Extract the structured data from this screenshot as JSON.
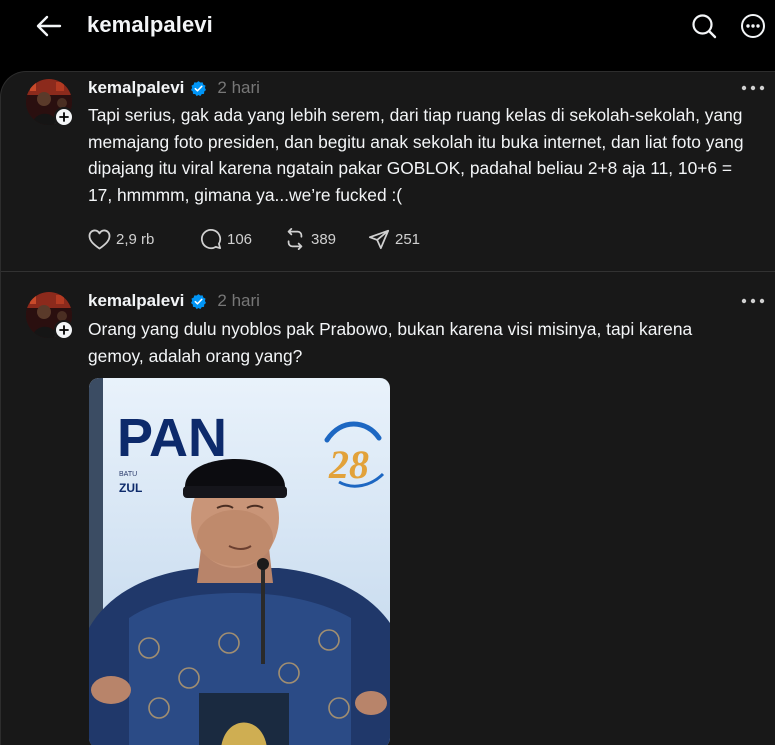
{
  "header": {
    "title": "kemalpalevi",
    "back_icon": "arrow-left-icon",
    "search_icon": "search-icon",
    "more_icon": "more-circle-icon"
  },
  "posts": [
    {
      "username": "kemalpalevi",
      "verified": true,
      "time": "2 hari",
      "text": "Tapi serius, gak ada yang lebih serem, dari tiap ruang kelas di sekolah-sekolah, yang memajang foto presiden, dan begitu anak sekolah itu buka internet, dan liat foto yang dipajang itu viral karena ngatain pakar GOBLOK, padahal beliau 2+8 aja 11, 10+6 = 17, hmmmm, gimana ya...we’re fucked :(",
      "likes": "2,9 rb",
      "replies": "106",
      "reposts": "389",
      "shares": "251"
    },
    {
      "username": "kemalpalevi",
      "verified": true,
      "time": "2 hari",
      "text": "Orang yang dulu nyoblos pak Prabowo, bukan karena visi misinya, tapi karena gemoy, adalah orang yang?",
      "media": {
        "logo_text": "PAN",
        "sub_text": "ZUL",
        "small_text": "BATU",
        "badge_number": "28",
        "suffix_text": "N"
      }
    }
  ],
  "colors": {
    "background": "#000000",
    "card": "#181818",
    "text": "#f3f5f7",
    "muted": "#777777",
    "verified": "#0095f6"
  }
}
